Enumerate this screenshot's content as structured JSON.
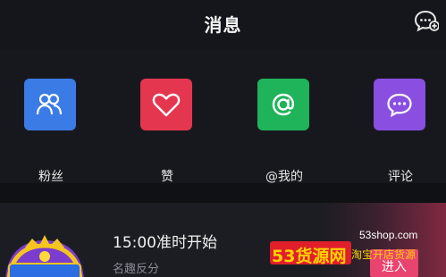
{
  "header": {
    "title": "消息",
    "add_chat_icon": "chat-plus-icon"
  },
  "tiles": [
    {
      "label": "粉丝",
      "icon": "fans-icon",
      "color": "#3a7be6"
    },
    {
      "label": "赞",
      "icon": "heart-icon",
      "color": "#e5364f"
    },
    {
      "label": "@我的",
      "icon": "at-icon",
      "color": "#1fb35a"
    },
    {
      "label": "评论",
      "icon": "comment-icon",
      "color": "#8a4fe0"
    }
  ],
  "row": {
    "title": "15:00准时开始",
    "subtitle": "名趣反分",
    "enter_label": "进入",
    "accent_color": "#e8446f"
  },
  "watermark": {
    "brand": "53货源网",
    "url": "53shop.com",
    "tagline": "淘宝开店货源"
  },
  "colors": {
    "background": "#17181e",
    "header": "#15161b",
    "row": "#1c1d23"
  }
}
